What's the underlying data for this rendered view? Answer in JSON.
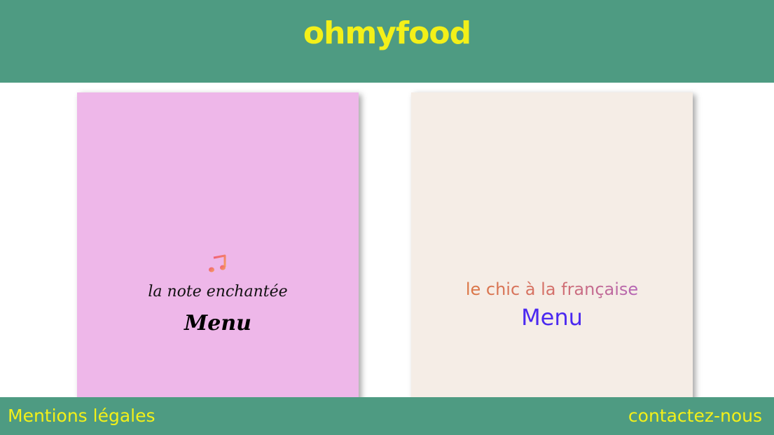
{
  "header": {
    "logo": "ohmyfood"
  },
  "cards": [
    {
      "icon": "music-note-icon",
      "title": "la note enchantée",
      "menu_label": "Menu",
      "background": "#eeb7e9"
    },
    {
      "title": "le chic à la française",
      "menu_label": "Menu",
      "background": "#f5ede6"
    }
  ],
  "footer": {
    "left_link": "Mentions légales",
    "right_link": "contactez-nous"
  },
  "colors": {
    "brand_green": "#4e9b82",
    "brand_yellow": "#f3f019",
    "menu_blue": "#4b29f0"
  }
}
